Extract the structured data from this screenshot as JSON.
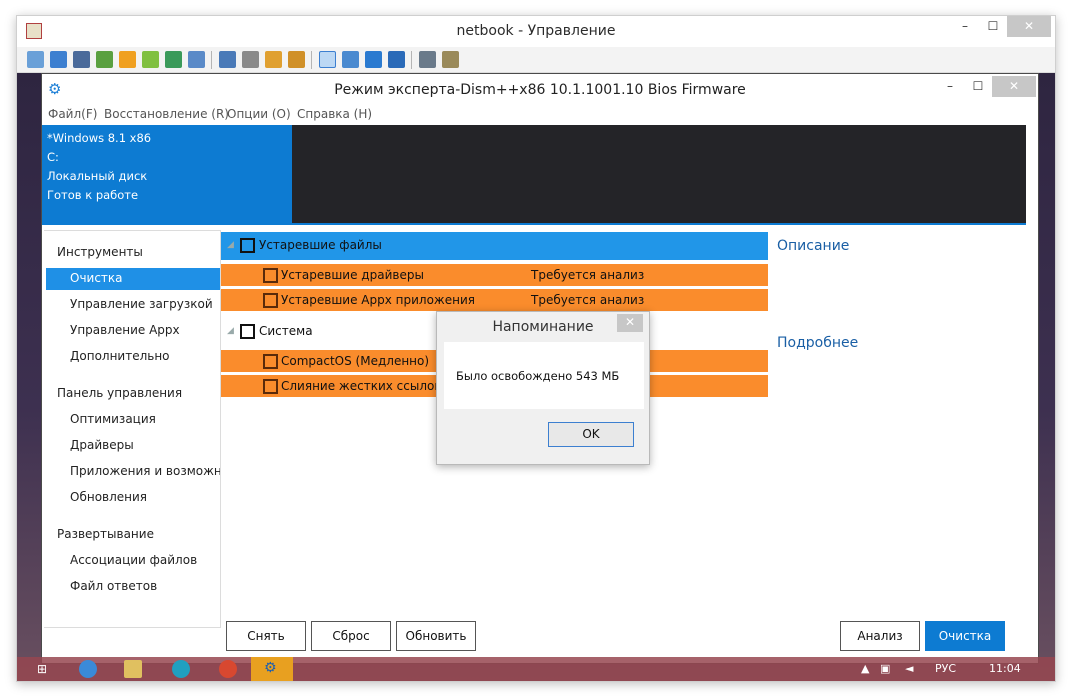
{
  "outer_window": {
    "title": "netbook - Управление",
    "minimize": "–",
    "maximize": "☐",
    "close": "✕"
  },
  "dism_window": {
    "title": "Режим эксперта-Dism++x86 10.1.1001.10 Bios Firmware",
    "minimize": "–",
    "maximize": "☐",
    "close": "✕"
  },
  "menu": [
    "Файл(F)",
    "Восстановление (R)",
    "Опции (O)",
    "Справка (H)"
  ],
  "info": {
    "os": "*Windows 8.1 x86",
    "drive": "C:",
    "disk": "Локальный диск",
    "status": "Готов к работе"
  },
  "sidebar": {
    "sections": [
      {
        "title": "Инструменты",
        "items": [
          "Очистка",
          "Управление загрузкой",
          "Управление Appx",
          "Дополнительно"
        ]
      },
      {
        "title": "Панель управления",
        "items": [
          "Оптимизация",
          "Драйверы",
          "Приложения и возможнос",
          "Обновления"
        ]
      },
      {
        "title": "Развертывание",
        "items": [
          "Ассоциации файлов",
          "Файл ответов"
        ]
      }
    ],
    "selected": "Очистка"
  },
  "cleanup": {
    "groups": [
      {
        "label": "Устаревшие файлы",
        "items": [
          {
            "label": "Устаревшие драйверы",
            "status": "Требуется анализ"
          },
          {
            "label": "Устаревшие Appx приложения",
            "status": "Требуется анализ"
          }
        ]
      },
      {
        "label": "Система",
        "items": [
          {
            "label": "CompactOS (Медленно)",
            "status": ""
          },
          {
            "label": "Слияние жестких ссылок (M",
            "status": ""
          }
        ]
      }
    ]
  },
  "panel": {
    "description": "Описание",
    "details": "Подробнее"
  },
  "buttons": {
    "remove": "Снять",
    "reset": "Сброс",
    "refresh": "Обновить",
    "analyze": "Анализ",
    "clean": "Очистка"
  },
  "dialog": {
    "title": "Напоминание",
    "message": "Было освобождено 543 МБ",
    "ok": "OK",
    "close": "✕"
  },
  "taskbar": {
    "language": "РУС",
    "time": "11:04"
  },
  "colors": {
    "accent": "#0d7bd2",
    "selected_group": "#2196e8",
    "item_row": "#fa8c2c",
    "dark_panel": "#242428"
  }
}
